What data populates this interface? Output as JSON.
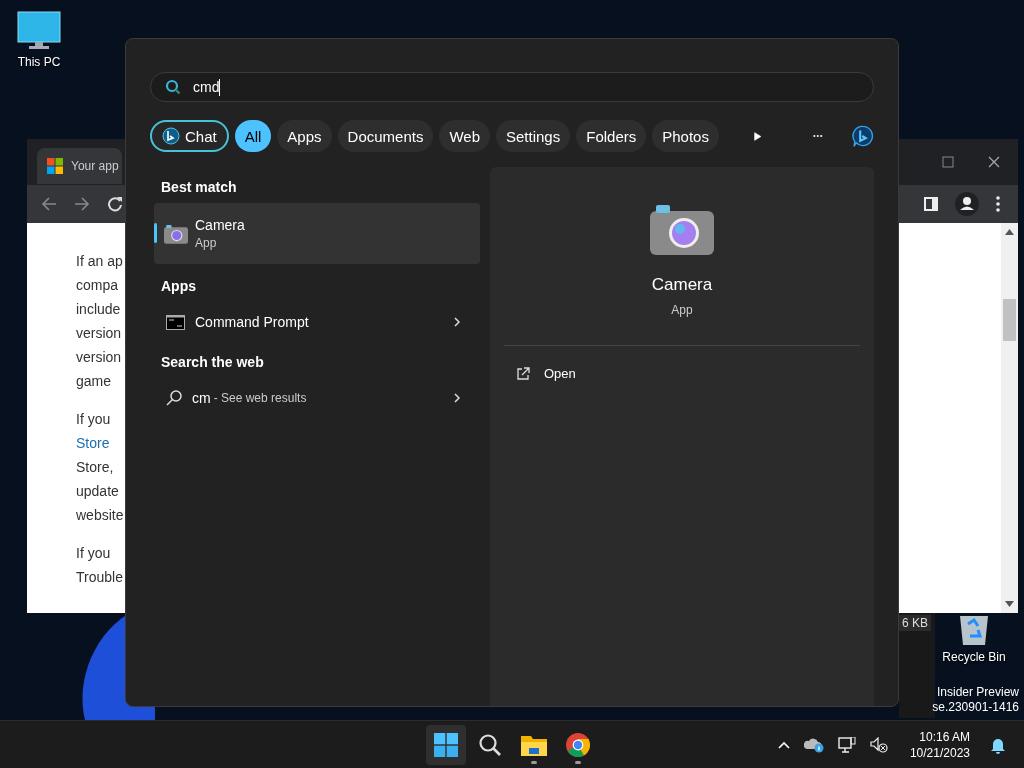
{
  "desktop": {
    "icons": [
      {
        "kind": "pc",
        "label": "This PC"
      },
      {
        "kind": "bin",
        "label": "Recycle Bin"
      }
    ],
    "background_window": {
      "size": "6 KB"
    },
    "watermark": [
      "Insider Preview",
      "se.230901-1416"
    ]
  },
  "browser": {
    "tab_title": "Your app",
    "paragraphs": [
      {
        "lines": [
          {
            "kind": "text",
            "text": "If an ap"
          },
          {
            "kind": "text",
            "text": "compa"
          },
          {
            "kind": "text",
            "text": "include"
          },
          {
            "kind": "text",
            "text": "version"
          },
          {
            "kind": "text",
            "text": "version"
          },
          {
            "kind": "text",
            "text": "game"
          }
        ]
      },
      {
        "lines": [
          {
            "kind": "text",
            "text": "If you"
          },
          {
            "kind": "link",
            "text": "Store"
          },
          {
            "kind": "text",
            "text": "Store,"
          },
          {
            "kind": "text",
            "text": "update"
          },
          {
            "kind": "text",
            "text": "website"
          }
        ]
      },
      {
        "lines": [
          {
            "kind": "text",
            "text": "If you"
          },
          {
            "kind": "text",
            "text": "Trouble"
          }
        ]
      }
    ]
  },
  "start_menu": {
    "search": {
      "value": "cmd"
    },
    "filters": [
      {
        "kind": "chat",
        "label": "Chat",
        "selected": false
      },
      {
        "kind": "filter",
        "label": "All",
        "selected": true
      },
      {
        "kind": "filter",
        "label": "Apps",
        "selected": false
      },
      {
        "kind": "filter",
        "label": "Documents",
        "selected": false
      },
      {
        "kind": "filter",
        "label": "Web",
        "selected": false
      },
      {
        "kind": "filter",
        "label": "Settings",
        "selected": false
      },
      {
        "kind": "filter",
        "label": "Folders",
        "selected": false
      },
      {
        "kind": "filter",
        "label": "Photos",
        "selected": false
      }
    ],
    "best_match": {
      "heading": "Best match",
      "name": "Camera",
      "type": "App",
      "selected": true
    },
    "apps": {
      "heading": "Apps",
      "items": [
        {
          "name": "Command Prompt"
        }
      ]
    },
    "web": {
      "heading": "Search the web",
      "query": "cm",
      "suffix": "- See web results"
    },
    "details": {
      "name": "Camera",
      "type": "App",
      "actions": [
        {
          "label": "Open"
        }
      ]
    }
  },
  "taskbar": {
    "apps": [
      {
        "kind": "start",
        "selected": true,
        "running": false
      },
      {
        "kind": "search",
        "selected": false,
        "running": false
      },
      {
        "kind": "explorer",
        "selected": false,
        "running": true
      },
      {
        "kind": "chrome",
        "selected": false,
        "running": true
      }
    ],
    "time": "10:16 AM",
    "date": "10/21/2023"
  }
}
